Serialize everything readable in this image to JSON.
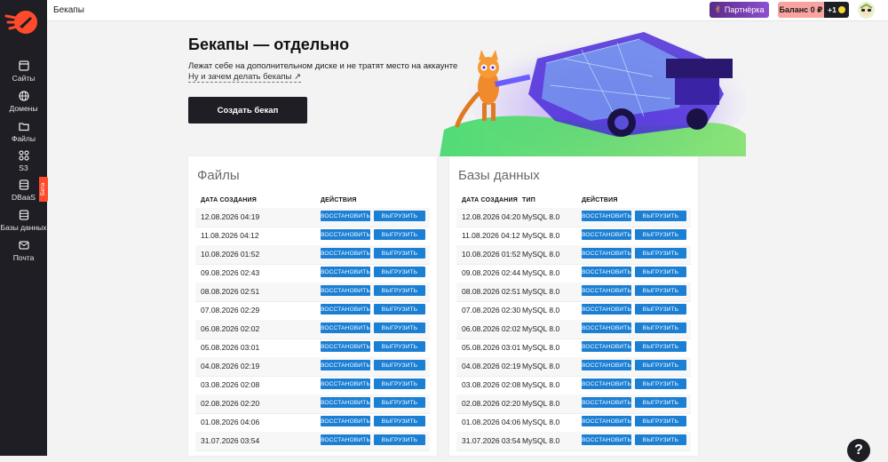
{
  "page": {
    "title": "Бекапы"
  },
  "sidebar": {
    "items": [
      {
        "label": "Сайты",
        "icon": "sites-icon"
      },
      {
        "label": "Домены",
        "icon": "globe-icon"
      },
      {
        "label": "Файлы",
        "icon": "folder-icon"
      },
      {
        "label": "S3",
        "icon": "grid-icon"
      },
      {
        "label": "DBaaS",
        "icon": "database-icon"
      },
      {
        "label": "Базы данных",
        "icon": "database-icon"
      },
      {
        "label": "Почта",
        "icon": "mail-icon"
      }
    ],
    "beta_label": "Бета"
  },
  "topbar": {
    "partner_label": "Партнёрка",
    "balance_label": "Баланс 0 ₽",
    "bonus_label": "+1"
  },
  "hero": {
    "title": "Бекапы — отдельно",
    "subtitle": "Лежат себе на дополнительном диске и не тратят место на аккаунте",
    "link": "Ну и зачем делать бекапы ↗",
    "create_button": "Создать бекап"
  },
  "files": {
    "title": "Файлы",
    "columns": {
      "date": "ДАТА СОЗДАНИЯ",
      "actions": "ДЕЙСТВИЯ"
    },
    "restore_label": "ВОССТАНОВИТЬ",
    "download_label": "ВЫГРУЗИТЬ",
    "rows": [
      "12.08.2026 04:19",
      "11.08.2026 04:12",
      "10.08.2026 01:52",
      "09.08.2026 02:43",
      "08.08.2026 02:51",
      "07.08.2026 02:29",
      "06.08.2026 02:02",
      "05.08.2026 03:01",
      "04.08.2026 02:19",
      "03.08.2026 02:08",
      "02.08.2026 02:20",
      "01.08.2026 04:06",
      "31.07.2026 03:54"
    ]
  },
  "databases": {
    "title": "Базы данных",
    "columns": {
      "date": "ДАТА СОЗДАНИЯ",
      "type": "ТИП",
      "actions": "ДЕЙСТВИЯ"
    },
    "restore_label": "ВОССТАНОВИТЬ",
    "download_label": "ВЫГРУЗИТЬ",
    "rows": [
      {
        "date": "12.08.2026 04:20",
        "type": "MySQL 8.0"
      },
      {
        "date": "11.08.2026 04:12",
        "type": "MySQL 8.0"
      },
      {
        "date": "10.08.2026 01:52",
        "type": "MySQL 8.0"
      },
      {
        "date": "09.08.2026 02:44",
        "type": "MySQL 8.0"
      },
      {
        "date": "08.08.2026 02:51",
        "type": "MySQL 8.0"
      },
      {
        "date": "07.08.2026 02:30",
        "type": "MySQL 8.0"
      },
      {
        "date": "06.08.2026 02:02",
        "type": "MySQL 8.0"
      },
      {
        "date": "05.08.2026 03:01",
        "type": "MySQL 8.0"
      },
      {
        "date": "04.08.2026 02:19",
        "type": "MySQL 8.0"
      },
      {
        "date": "03.08.2026 02:08",
        "type": "MySQL 8.0"
      },
      {
        "date": "02.08.2026 02:20",
        "type": "MySQL 8.0"
      },
      {
        "date": "01.08.2026 04:06",
        "type": "MySQL 8.0"
      },
      {
        "date": "31.07.2026 03:54",
        "type": "MySQL 8.0"
      }
    ]
  },
  "help": {
    "label": "?"
  },
  "colors": {
    "accent": "#1b7fd4",
    "sidebar": "#1e1e24",
    "brand": "#ff4b2b",
    "balance": "#f9a3a1"
  }
}
